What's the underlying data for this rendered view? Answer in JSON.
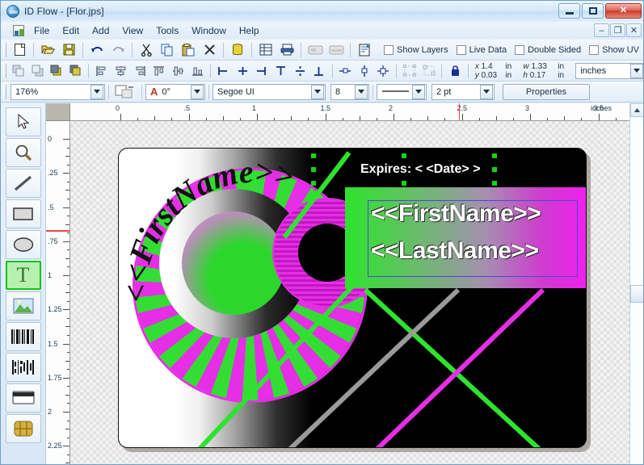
{
  "window": {
    "title": "ID Flow - [Flor.jps]",
    "icon": "app-globe-icon",
    "minimize": "minimize-icon",
    "maximize": "maximize-icon",
    "close": "close-icon",
    "mdi_minimize": "–",
    "mdi_restore": "❐",
    "mdi_close": "✕"
  },
  "menu": {
    "items": [
      {
        "label": "File"
      },
      {
        "label": "Edit"
      },
      {
        "label": "Add"
      },
      {
        "label": "View"
      },
      {
        "label": "Tools"
      },
      {
        "label": "Window"
      },
      {
        "label": "Help"
      }
    ]
  },
  "toolbar_top": {
    "buttons": [
      {
        "name": "new-file-button",
        "icon": "new-document-icon"
      },
      {
        "name": "open-file-button",
        "icon": "open-folder-icon"
      },
      {
        "name": "save-file-button",
        "icon": "floppy-save-icon"
      },
      {
        "name": "undo-button",
        "icon": "undo-arrow-icon"
      },
      {
        "name": "redo-button",
        "icon": "redo-arrow-icon"
      },
      {
        "name": "cut-button",
        "icon": "scissors-icon"
      },
      {
        "name": "copy-button",
        "icon": "copy-pages-icon"
      },
      {
        "name": "paste-button",
        "icon": "clipboard-paste-icon"
      },
      {
        "name": "delete-button",
        "icon": "x-delete-icon"
      },
      {
        "name": "database-button",
        "icon": "database-cylinder-icon"
      },
      {
        "name": "records-button",
        "icon": "grid-records-icon"
      },
      {
        "name": "print-button",
        "icon": "printer-icon"
      },
      {
        "name": "card-front-button",
        "icon": "card-front-icon"
      },
      {
        "name": "card-back-button",
        "icon": "card-back-icon"
      },
      {
        "name": "preview-button",
        "icon": "preview-page-icon"
      }
    ],
    "checkboxes": [
      {
        "label": "Show Layers",
        "checked": false
      },
      {
        "label": "Live Data",
        "checked": false
      },
      {
        "label": "Double Sided",
        "checked": false
      },
      {
        "label": "Show UV",
        "checked": false
      }
    ]
  },
  "toolbar_align": {
    "buttons": [
      {
        "name": "bring-to-front-button",
        "icon": "bring-to-front-icon"
      },
      {
        "name": "send-to-back-button",
        "icon": "send-to-back-icon"
      },
      {
        "name": "bring-forward-button",
        "icon": "bring-forward-icon"
      },
      {
        "name": "send-backward-button",
        "icon": "send-backward-icon"
      },
      {
        "name": "align-left-button",
        "icon": "align-left-icon"
      },
      {
        "name": "align-center-h-button",
        "icon": "align-center-horizontal-icon"
      },
      {
        "name": "align-right-button",
        "icon": "align-right-icon"
      },
      {
        "name": "align-top-button",
        "icon": "align-top-icon"
      },
      {
        "name": "align-middle-button",
        "icon": "align-middle-icon"
      },
      {
        "name": "align-bottom-button",
        "icon": "align-bottom-icon"
      },
      {
        "name": "align-edge-left-button",
        "icon": "edge-left-icon"
      },
      {
        "name": "align-edge-center-button",
        "icon": "edge-center-icon"
      },
      {
        "name": "align-edge-right-button",
        "icon": "edge-right-icon"
      },
      {
        "name": "distribute-top-button",
        "icon": "distribute-top-icon"
      },
      {
        "name": "distribute-mid-button",
        "icon": "distribute-middle-icon"
      },
      {
        "name": "distribute-bottom-button",
        "icon": "distribute-bottom-icon"
      },
      {
        "name": "size-same-width-button",
        "icon": "same-width-icon"
      },
      {
        "name": "size-same-height-button",
        "icon": "same-height-icon"
      },
      {
        "name": "size-same-both-button",
        "icon": "same-size-icon"
      },
      {
        "name": "group-button",
        "icon": "group-objects-icon"
      },
      {
        "name": "ungroup-button",
        "icon": "ungroup-objects-icon"
      },
      {
        "name": "lock-button",
        "icon": "padlock-icon"
      }
    ],
    "position": {
      "x_label": "x",
      "x_value": "1.4",
      "x_unit": "in",
      "y_label": "y",
      "y_value": "0.03",
      "y_unit": "in",
      "w_label": "w",
      "w_value": "1.33",
      "w_unit": "in",
      "h_label": "h",
      "h_value": "0.17",
      "h_unit": "in"
    },
    "units": {
      "value": "inches"
    }
  },
  "toolbar_format": {
    "zoom": {
      "value": "176%"
    },
    "fill_swatch": "fill-color-swatch",
    "rotation": {
      "glyph": "A",
      "value": "0°"
    },
    "font": {
      "value": "Segoe UI"
    },
    "font_size": {
      "value": "8"
    },
    "line_style": {
      "value": "line-solid"
    },
    "line_weight": {
      "value": "2 pt"
    },
    "properties_button": "Properties"
  },
  "tool_palette": {
    "tools": [
      {
        "name": "select-tool",
        "icon": "pointer-arrow-icon",
        "active": false
      },
      {
        "name": "zoom-tool",
        "icon": "magnifier-icon",
        "active": false
      },
      {
        "name": "line-tool",
        "icon": "diagonal-line-icon",
        "active": false
      },
      {
        "name": "rectangle-tool",
        "icon": "rectangle-icon",
        "active": false
      },
      {
        "name": "ellipse-tool",
        "icon": "ellipse-icon",
        "active": false
      },
      {
        "name": "text-tool",
        "icon": "text-t-icon",
        "active": true,
        "label": "T"
      },
      {
        "name": "image-tool",
        "icon": "picture-icon",
        "active": false
      },
      {
        "name": "barcode-tool",
        "icon": "barcode-1d-icon",
        "active": false
      },
      {
        "name": "barcode-2d-tool",
        "icon": "barcode-2d-icon",
        "active": false
      },
      {
        "name": "magstripe-tool",
        "icon": "magnetic-stripe-icon",
        "active": false
      },
      {
        "name": "smartcard-tool",
        "icon": "smartcard-chip-icon",
        "active": false
      }
    ]
  },
  "rulers": {
    "unit_label": "inches",
    "horizontal_ticks": [
      "0",
      ".5",
      "1",
      "1.5",
      "2",
      "2.5",
      "3",
      "3.5"
    ],
    "vertical_ticks": [
      "0",
      ".25",
      ".5",
      ".75",
      "1",
      "1.25",
      "1.5",
      "1.75",
      "2",
      "2.25"
    ],
    "h_marker_value": "2.5",
    "v_marker_value": ".75"
  },
  "card": {
    "expires_text": "Expires: < <Date> >",
    "first_name_field": "<<FirstName>>",
    "last_name_field": "<<LastName>>",
    "arc_text": "<<FirstName>>",
    "colors": {
      "background": "#000000",
      "green": "#2ee32e",
      "magenta": "#e62ee6",
      "gray_line": "#9a9a9a",
      "selection_handle": "#16d216",
      "text_box_border": "#4a4ad0"
    }
  },
  "scrollbar": {
    "up_arrow": "scroll-up-icon"
  }
}
